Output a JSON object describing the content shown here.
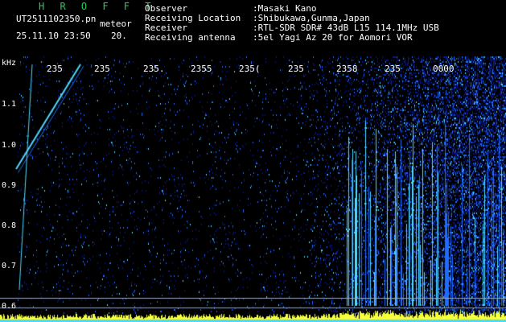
{
  "header": {
    "title": "H R O F F T",
    "filename": "UT2511102350.pn",
    "mode": "meteor",
    "timestamp": "25.11.10 23:50",
    "speed": "20."
  },
  "info": [
    {
      "key": "Observer",
      "value": ":Masaki Kano"
    },
    {
      "key": "Receiving Location",
      "value": ":Shibukawa,Gunma,Japan"
    },
    {
      "key": "Receiver",
      "value": ":RTL-SDR SDR# 43dB L15 114.1MHz USB"
    },
    {
      "key": "Receiving antenna",
      "value": ":5el Yagi Az 20 for Aomori VOR"
    }
  ],
  "axis": {
    "unit": "kHz",
    "y_ticks": [
      "1.1",
      "1.0",
      "0.9",
      "0.8",
      "0.7",
      "0.6"
    ],
    "x_ticks": [
      "235",
      "235",
      "235.",
      "2355",
      "235(",
      "235",
      "2358",
      "235",
      "0000"
    ]
  },
  "colors": {
    "background": "#000000",
    "title": "#22d05a",
    "text": "#ffffff",
    "signal_low": "#0a1a8a",
    "signal_mid": "#1e6cff",
    "signal_high": "#4fd9ff",
    "signal_peak": "#f6ff3a"
  }
}
